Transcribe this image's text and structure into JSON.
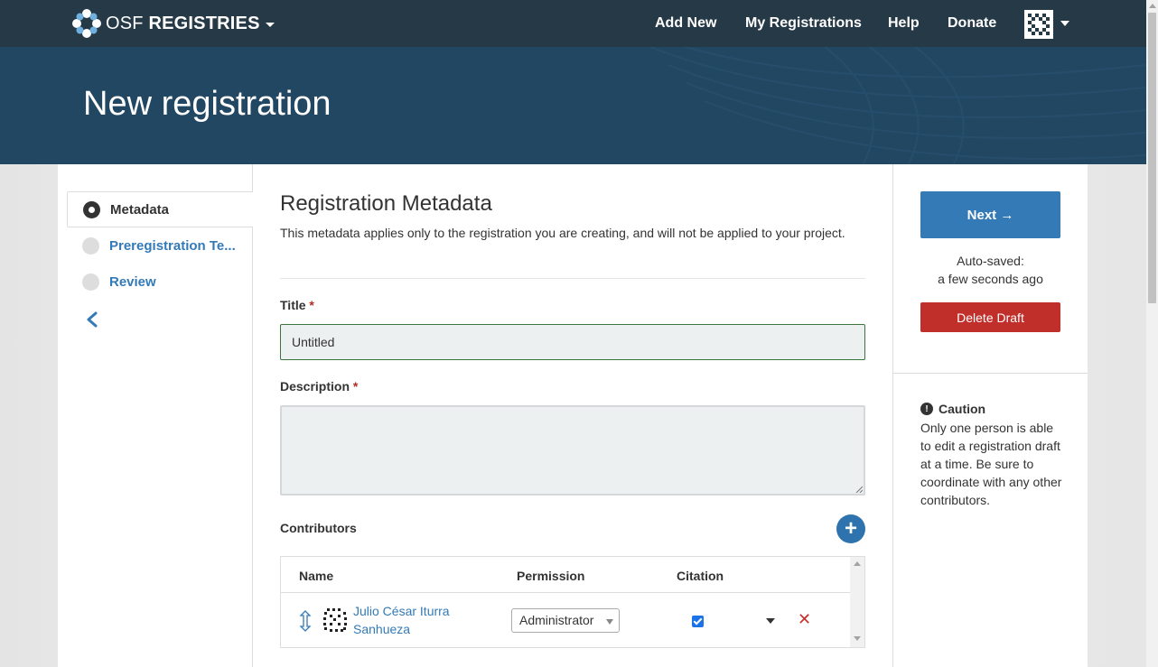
{
  "navbar": {
    "brand_osf": "OSF",
    "brand_product": "REGISTRIES",
    "links": [
      "Add New",
      "My Registrations",
      "Help",
      "Donate"
    ]
  },
  "hero": {
    "title": "New registration"
  },
  "sidebar": {
    "steps": [
      {
        "label": "Metadata",
        "state": "active"
      },
      {
        "label": "Preregistration Te...",
        "state": "pending"
      },
      {
        "label": "Review",
        "state": "pending"
      }
    ]
  },
  "main": {
    "heading": "Registration Metadata",
    "intro": "This metadata applies only to the registration you are creating, and will not be applied to your project.",
    "title_label": "Title",
    "title_value": "Untitled",
    "description_label": "Description",
    "description_value": "",
    "required_marker": "*",
    "contributors_label": "Contributors",
    "add_contributor_symbol": "+",
    "table": {
      "headers": [
        "Name",
        "Permission",
        "Citation"
      ],
      "rows": [
        {
          "name": "Julio César Iturra Sanhueza",
          "permission": "Administrator",
          "citation": true
        }
      ]
    },
    "remove_symbol": "✕"
  },
  "right_panel": {
    "next_label": "Next →",
    "autosave_line1": "Auto-saved:",
    "autosave_line2": "a few seconds ago",
    "delete_label": "Delete Draft",
    "caution_title": "Caution",
    "caution_text": "Only one person is able to edit a registration draft at a time. Be sure to coordinate with any other contributors."
  },
  "colors": {
    "navbar": "#263947",
    "hero": "#214762",
    "primary": "#337ab7",
    "danger": "#c12f2a",
    "title_input_border": "#3c763d"
  }
}
